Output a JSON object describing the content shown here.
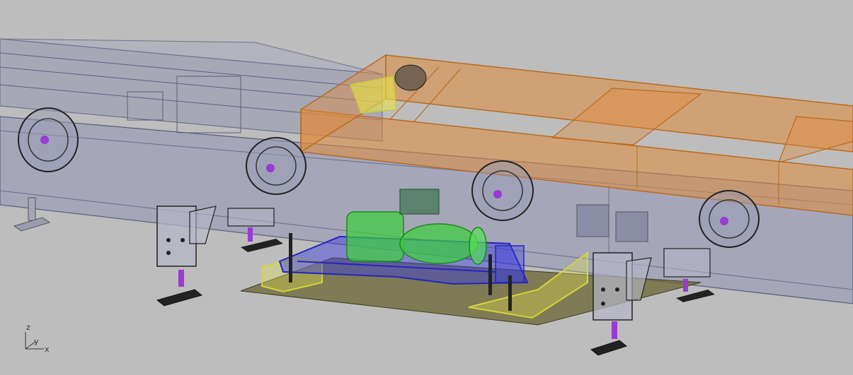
{
  "viewport": {
    "view": "Perspective",
    "background_color": "#bdbdbd"
  },
  "axis_gizmo": {
    "z_label": "z",
    "y_label": "y",
    "x_label": "x"
  },
  "colors": {
    "rail_frame": "#8a8ca8",
    "orange_frame": "#e08a3a",
    "drive_unit": "#3ad13a",
    "blue_frame": "#3a3ae0",
    "yellow_bracket": "#e6e64a",
    "base_plate": "#6f6a3a",
    "axle_marker": "#9a3ad1"
  }
}
